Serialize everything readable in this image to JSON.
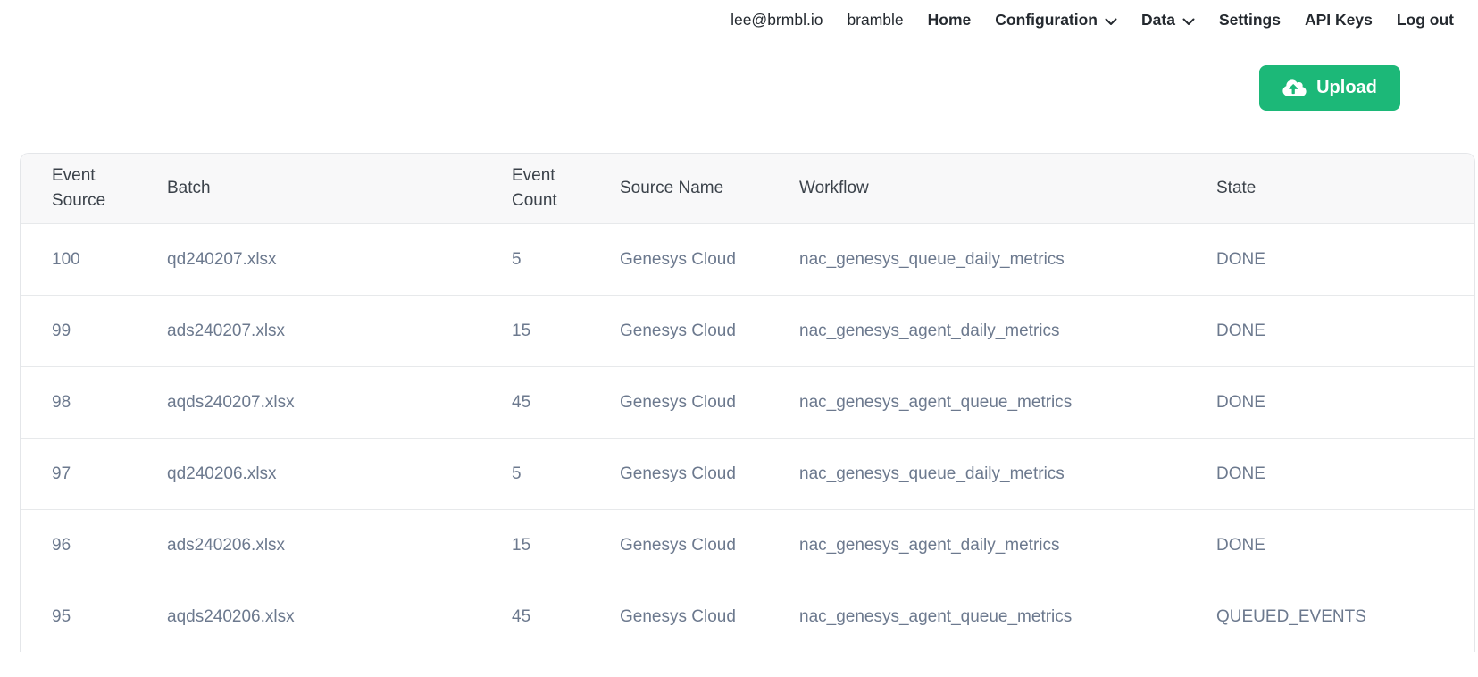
{
  "navbar": {
    "user_email": "lee@brmbl.io",
    "org_name": "bramble",
    "items": [
      {
        "label": "Home",
        "has_dropdown": false
      },
      {
        "label": "Configuration",
        "has_dropdown": true
      },
      {
        "label": "Data",
        "has_dropdown": true
      },
      {
        "label": "Settings",
        "has_dropdown": false
      },
      {
        "label": "API Keys",
        "has_dropdown": false
      },
      {
        "label": "Log out",
        "has_dropdown": false
      }
    ]
  },
  "toolbar": {
    "upload_label": "Upload",
    "upload_icon": "cloud-upload-icon"
  },
  "table": {
    "columns": [
      "Event Source",
      "Batch",
      "Event Count",
      "Source Name",
      "Workflow",
      "State"
    ],
    "rows": [
      {
        "event_source": "100",
        "batch": "qd240207.xlsx",
        "event_count": "5",
        "source_name": "Genesys Cloud",
        "workflow": "nac_genesys_queue_daily_metrics",
        "state": "DONE"
      },
      {
        "event_source": "99",
        "batch": "ads240207.xlsx",
        "event_count": "15",
        "source_name": "Genesys Cloud",
        "workflow": "nac_genesys_agent_daily_metrics",
        "state": "DONE"
      },
      {
        "event_source": "98",
        "batch": "aqds240207.xlsx",
        "event_count": "45",
        "source_name": "Genesys Cloud",
        "workflow": "nac_genesys_agent_queue_metrics",
        "state": "DONE"
      },
      {
        "event_source": "97",
        "batch": "qd240206.xlsx",
        "event_count": "5",
        "source_name": "Genesys Cloud",
        "workflow": "nac_genesys_queue_daily_metrics",
        "state": "DONE"
      },
      {
        "event_source": "96",
        "batch": "ads240206.xlsx",
        "event_count": "15",
        "source_name": "Genesys Cloud",
        "workflow": "nac_genesys_agent_daily_metrics",
        "state": "DONE"
      },
      {
        "event_source": "95",
        "batch": "aqds240206.xlsx",
        "event_count": "45",
        "source_name": "Genesys Cloud",
        "workflow": "nac_genesys_agent_queue_metrics",
        "state": "QUEUED_EVENTS"
      }
    ]
  },
  "colors": {
    "accent_green": "#1cb878",
    "nav_text": "#24292f",
    "header_text": "#3b424a",
    "body_text": "#6c798e",
    "border": "#e7e9eb",
    "header_bg": "#f8f8f9"
  }
}
